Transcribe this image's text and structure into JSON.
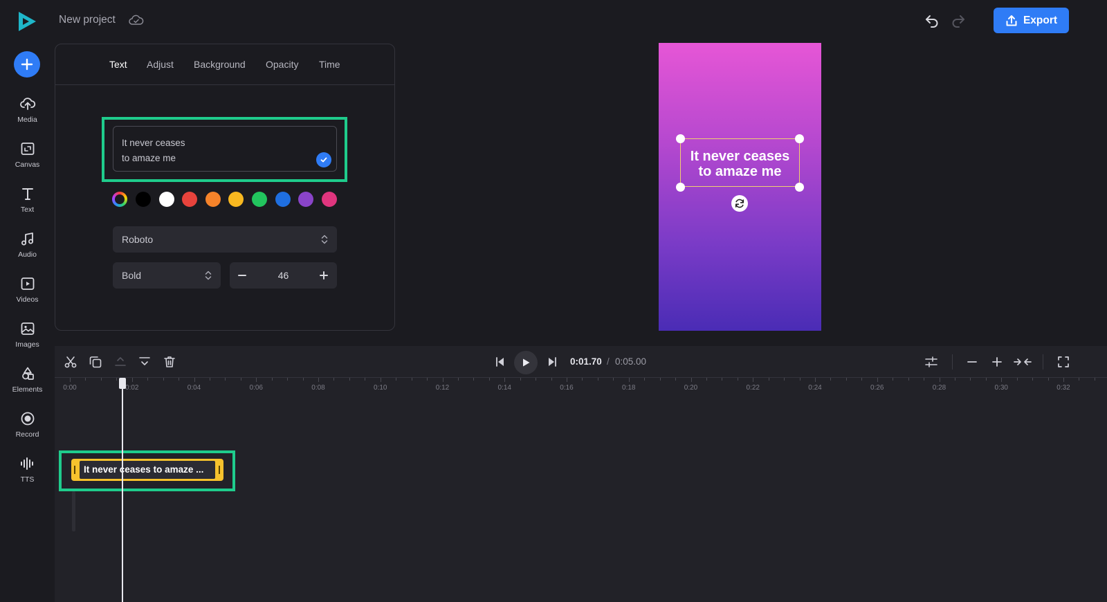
{
  "header": {
    "project_title": "New project",
    "export_label": "Export"
  },
  "sidebar": {
    "items": [
      {
        "label": "Media",
        "icon": "upload-cloud-icon"
      },
      {
        "label": "Canvas",
        "icon": "canvas-icon"
      },
      {
        "label": "Text",
        "icon": "text-icon"
      },
      {
        "label": "Audio",
        "icon": "music-note-icon"
      },
      {
        "label": "Videos",
        "icon": "video-icon"
      },
      {
        "label": "Images",
        "icon": "image-icon"
      },
      {
        "label": "Elements",
        "icon": "shapes-icon"
      },
      {
        "label": "Record",
        "icon": "record-icon"
      },
      {
        "label": "TTS",
        "icon": "waveform-icon"
      }
    ]
  },
  "panel": {
    "tabs": [
      {
        "label": "Text",
        "active": true
      },
      {
        "label": "Adjust",
        "active": false
      },
      {
        "label": "Background",
        "active": false
      },
      {
        "label": "Opacity",
        "active": false
      },
      {
        "label": "Time",
        "active": false
      }
    ],
    "text_lines": [
      "It never ceases",
      "to amaze me"
    ],
    "colors": [
      "rainbow",
      "#000000",
      "#ffffff",
      "#e8433c",
      "#f5832a",
      "#f8b820",
      "#22c55e",
      "#1f6fe0",
      "#8a44c9",
      "#e0357e"
    ],
    "font_family": "Roboto",
    "font_weight": "Bold",
    "font_size": "46"
  },
  "preview": {
    "text_lines": [
      "It never ceases",
      "to amaze me"
    ]
  },
  "timeline": {
    "current_time": "0:01.70",
    "separator": "/",
    "total_time": "0:05.00",
    "ticks": [
      "0:00",
      "0:02",
      "0:04",
      "0:06",
      "0:08",
      "0:10",
      "0:12",
      "0:14",
      "0:16",
      "0:18",
      "0:20",
      "0:22",
      "0:24",
      "0:26",
      "0:28",
      "0:30",
      "0:32"
    ],
    "clip_label": "It never ceases to amaze ..."
  }
}
